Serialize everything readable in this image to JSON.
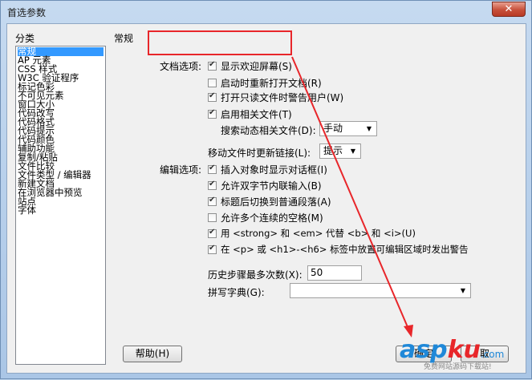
{
  "window": {
    "title": "首选参数",
    "close_glyph": "✕"
  },
  "categories": {
    "label": "分类",
    "items": [
      "常规",
      "AP 元素",
      "CSS 样式",
      "W3C 验证程序",
      "标记色彩",
      "不可见元素",
      "窗口大小",
      "代码改写",
      "代码格式",
      "代码提示",
      "代码颜色",
      "辅助功能",
      "复制/粘贴",
      "文件比较",
      "文件类型 / 编辑器",
      "新建文档",
      "在浏览器中预览",
      "站点",
      "字体"
    ],
    "selected_index": 0
  },
  "section_title": "常规",
  "doc_options": {
    "label": "文档选项:",
    "show_welcome": {
      "label": "显示欢迎屏幕(S)",
      "checked": true
    },
    "reopen_docs": {
      "label": "启动时重新打开文档(R)",
      "checked": false
    },
    "warn_readonly": {
      "label": "打开只读文件时警告用户(W)",
      "checked": true
    },
    "enable_related": {
      "label": "启用相关文件(T)",
      "checked": true
    },
    "search_dynamic": {
      "label": "搜索动态相关文件(D):",
      "value": "手动"
    },
    "update_links": {
      "label": "移动文件时更新链接(L):",
      "value": "提示"
    }
  },
  "edit_options": {
    "label": "编辑选项:",
    "items": [
      {
        "label": "插入对象时显示对话框(I)",
        "checked": true
      },
      {
        "label": "允许双字节内联输入(B)",
        "checked": true
      },
      {
        "label": "标题后切换到普通段落(A)",
        "checked": true
      },
      {
        "label": "允许多个连续的空格(M)",
        "checked": false
      },
      {
        "label": "用 <strong> 和 <em> 代替 <b> 和 <i>(U)",
        "checked": true
      },
      {
        "label": "在 <p> 或 <h1>-<h6> 标签中放置可编辑区域时发出警告",
        "checked": true
      }
    ]
  },
  "history": {
    "label": "历史步骤最多次数(X):",
    "value": "50"
  },
  "spelling": {
    "label": "拼写字典(G):",
    "value": ""
  },
  "buttons": {
    "help": "帮助(H)",
    "ok": "确定",
    "cancel": "取"
  },
  "watermark": {
    "brand_asp": "asp",
    "brand_ku": "ku",
    "brand_tld": ".com",
    "tagline": "免费网站源码下载站!"
  },
  "colors": {
    "highlight": "#e8262a",
    "arrow": "#e8262a",
    "selection": "#3399ff"
  }
}
